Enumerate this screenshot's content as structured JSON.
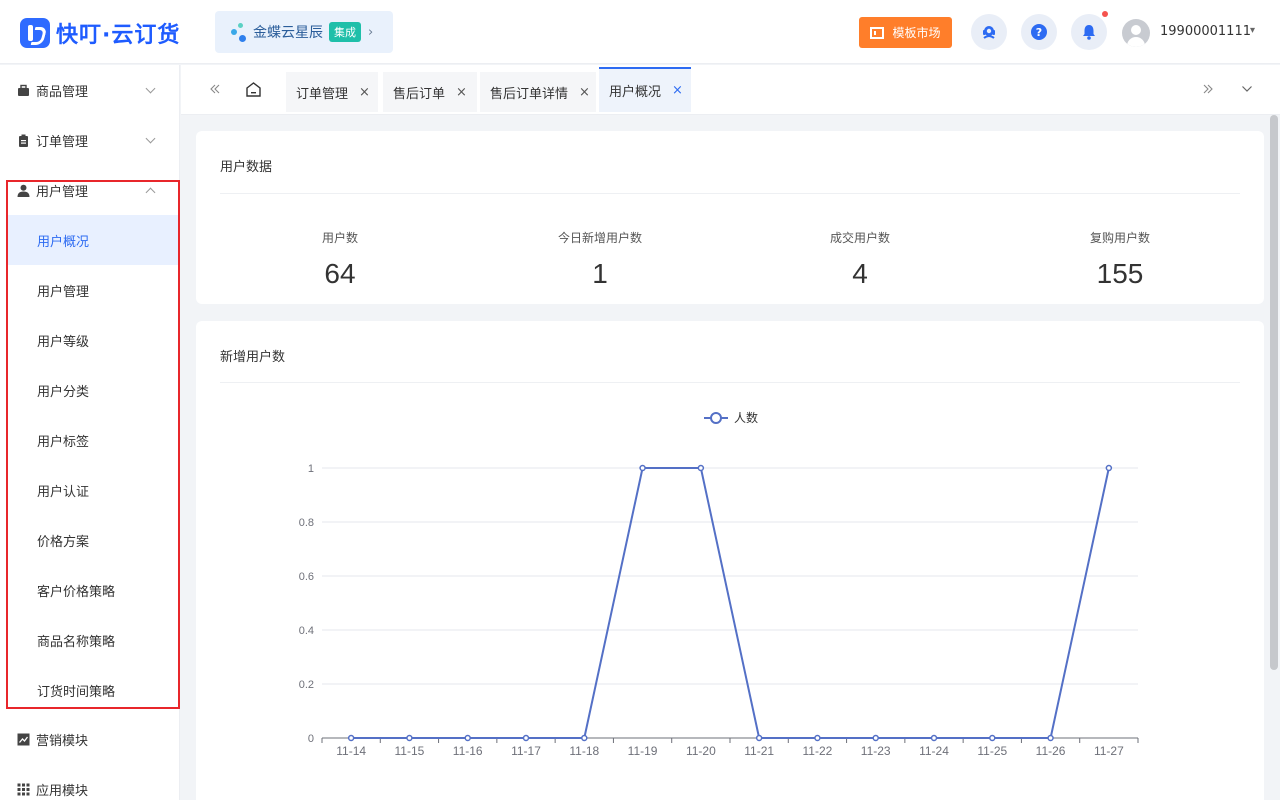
{
  "header": {
    "logo_text": "快叮·云订货",
    "brand": {
      "name": "金蝶云星辰",
      "badge": "集成",
      "arrow": "›"
    },
    "template_button": "模板市场",
    "username": "19900001111",
    "icons": [
      "service-icon",
      "help-icon",
      "bell-icon"
    ]
  },
  "sidebar": {
    "groups": [
      {
        "label": "商品管理",
        "icon": "briefcase-icon",
        "expanded": false
      },
      {
        "label": "订单管理",
        "icon": "clipboard-icon",
        "expanded": false
      },
      {
        "label": "用户管理",
        "icon": "user-icon",
        "expanded": true,
        "items": [
          "用户概况",
          "用户管理",
          "用户等级",
          "用户分类",
          "用户标签",
          "用户认证",
          "价格方案",
          "客户价格策略",
          "商品名称策略",
          "订货时间策略"
        ],
        "active_item": "用户概况"
      },
      {
        "label": "营销模块",
        "icon": "trend-icon",
        "expanded": false
      },
      {
        "label": "应用模块",
        "icon": "grid-icon",
        "expanded": false
      }
    ]
  },
  "tabs": {
    "items": [
      "订单管理",
      "售后订单",
      "售后订单详情",
      "用户概况"
    ],
    "active": "用户概况",
    "close_glyph": "×"
  },
  "user_data": {
    "title": "用户数据",
    "stats": [
      {
        "label": "用户数",
        "value": "64"
      },
      {
        "label": "今日新增用户数",
        "value": "1"
      },
      {
        "label": "成交用户数",
        "value": "4"
      },
      {
        "label": "复购用户数",
        "value": "155"
      }
    ]
  },
  "new_users": {
    "title": "新增用户数"
  },
  "chart_data": {
    "type": "line",
    "categories": [
      "11-14",
      "11-15",
      "11-16",
      "11-17",
      "11-18",
      "11-19",
      "11-20",
      "11-21",
      "11-22",
      "11-23",
      "11-24",
      "11-25",
      "11-26",
      "11-27"
    ],
    "series": [
      {
        "name": "人数",
        "values": [
          0,
          0,
          0,
          0,
          0,
          1,
          1,
          0,
          0,
          0,
          0,
          0,
          0,
          1
        ],
        "color": "#5470c6"
      }
    ],
    "yticks": [
      "0",
      "0.2",
      "0.4",
      "0.6",
      "0.8",
      "1"
    ],
    "ylim": [
      0,
      1
    ],
    "grid": true,
    "legend": "top-center"
  },
  "colors": {
    "primary": "#2d6bf2",
    "orange": "#ff7e2a",
    "highlight_border": "#e8262b"
  }
}
